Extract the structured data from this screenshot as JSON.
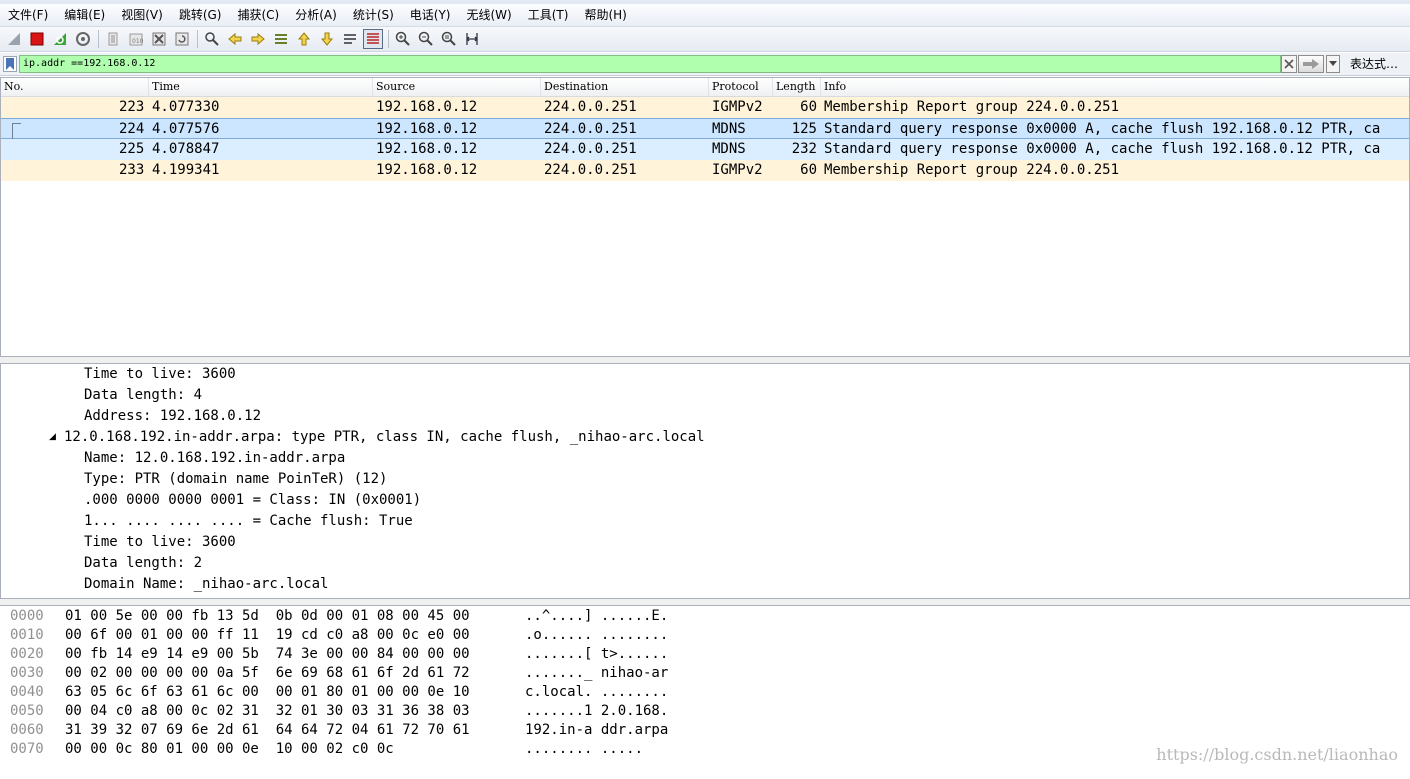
{
  "menu": [
    "文件(F)",
    "编辑(E)",
    "视图(V)",
    "跳转(G)",
    "捕获(C)",
    "分析(A)",
    "统计(S)",
    "电话(Y)",
    "无线(W)",
    "工具(T)",
    "帮助(H)"
  ],
  "toolbar_icons": [
    "start-capture-icon",
    "stop-capture-icon",
    "restart-capture-icon",
    "capture-options-icon",
    "open-file-icon",
    "save-file-icon",
    "close-file-icon",
    "reload-file-icon",
    "find-packet-icon",
    "go-back-icon",
    "go-forward-icon",
    "go-to-packet-icon",
    "first-packet-icon",
    "last-packet-icon",
    "auto-scroll-icon",
    "colorize-icon",
    "zoom-in-icon",
    "zoom-out-icon",
    "normal-size-icon",
    "resize-columns-icon"
  ],
  "filter": {
    "value": "ip.addr ==192.168.0.12",
    "expression_label": "表达式…"
  },
  "packet_list": {
    "columns": [
      "No.",
      "Time",
      "Source",
      "Destination",
      "Protocol",
      "Length",
      "Info"
    ],
    "rows": [
      {
        "no": "223",
        "time": "4.077330",
        "src": "192.168.0.12",
        "dst": "224.0.0.251",
        "proto": "IGMPv2",
        "len": "60",
        "info": "Membership Report group 224.0.0.251"
      },
      {
        "no": "224",
        "time": "4.077576",
        "src": "192.168.0.12",
        "dst": "224.0.0.251",
        "proto": "MDNS",
        "len": "125",
        "info": "Standard query response 0x0000 A, cache flush 192.168.0.12 PTR, ca"
      },
      {
        "no": "225",
        "time": "4.078847",
        "src": "192.168.0.12",
        "dst": "224.0.0.251",
        "proto": "MDNS",
        "len": "232",
        "info": "Standard query response 0x0000 A, cache flush 192.168.0.12 PTR, ca"
      },
      {
        "no": "233",
        "time": "4.199341",
        "src": "192.168.0.12",
        "dst": "224.0.0.251",
        "proto": "IGMPv2",
        "len": "60",
        "info": "Membership Report group 224.0.0.251"
      }
    ]
  },
  "details": {
    "lines": [
      "Time to live: 3600",
      "Data length: 4",
      "Address: 192.168.0.12",
      "12.0.168.192.in-addr.arpa: type PTR, class IN, cache flush, _nihao-arc.local",
      "Name: 12.0.168.192.in-addr.arpa",
      "Type: PTR (domain name PoinTeR) (12)",
      ".000 0000 0000 0001 = Class: IN (0x0001)",
      "1... .... .... .... = Cache flush: True",
      "Time to live: 3600",
      "Data length: 2",
      "Domain Name: _nihao-arc.local"
    ],
    "expand_arrow": "◢"
  },
  "bytes": {
    "rows": [
      {
        "offset": "0000",
        "hex": "01 00 5e 00 00 fb 13 5d  0b 0d 00 01 08 00 45 00",
        "ascii": "..^....] ......E."
      },
      {
        "offset": "0010",
        "hex": "00 6f 00 01 00 00 ff 11  19 cd c0 a8 00 0c e0 00",
        "ascii": ".o...... ........"
      },
      {
        "offset": "0020",
        "hex": "00 fb 14 e9 14 e9 00 5b  74 3e 00 00 84 00 00 00",
        "ascii": ".......[ t>......"
      },
      {
        "offset": "0030",
        "hex": "00 02 00 00 00 00 0a 5f  6e 69 68 61 6f 2d 61 72",
        "ascii": "......._ nihao-ar"
      },
      {
        "offset": "0040",
        "hex": "63 05 6c 6f 63 61 6c 00  00 01 80 01 00 00 0e 10",
        "ascii": "c.local. ........"
      },
      {
        "offset": "0050",
        "hex": "00 04 c0 a8 00 0c 02 31  32 01 30 03 31 36 38 03",
        "ascii": ".......1 2.0.168."
      },
      {
        "offset": "0060",
        "hex": "31 39 32 07 69 6e 2d 61  64 64 72 04 61 72 70 61",
        "ascii": "192.in-a ddr.arpa"
      },
      {
        "offset": "0070",
        "hex": "00 00 0c 80 01 00 00 0e  10 00 02 c0 0c",
        "ascii": "........ ....."
      }
    ]
  },
  "watermark": "https://blog.csdn.net/liaonhao"
}
